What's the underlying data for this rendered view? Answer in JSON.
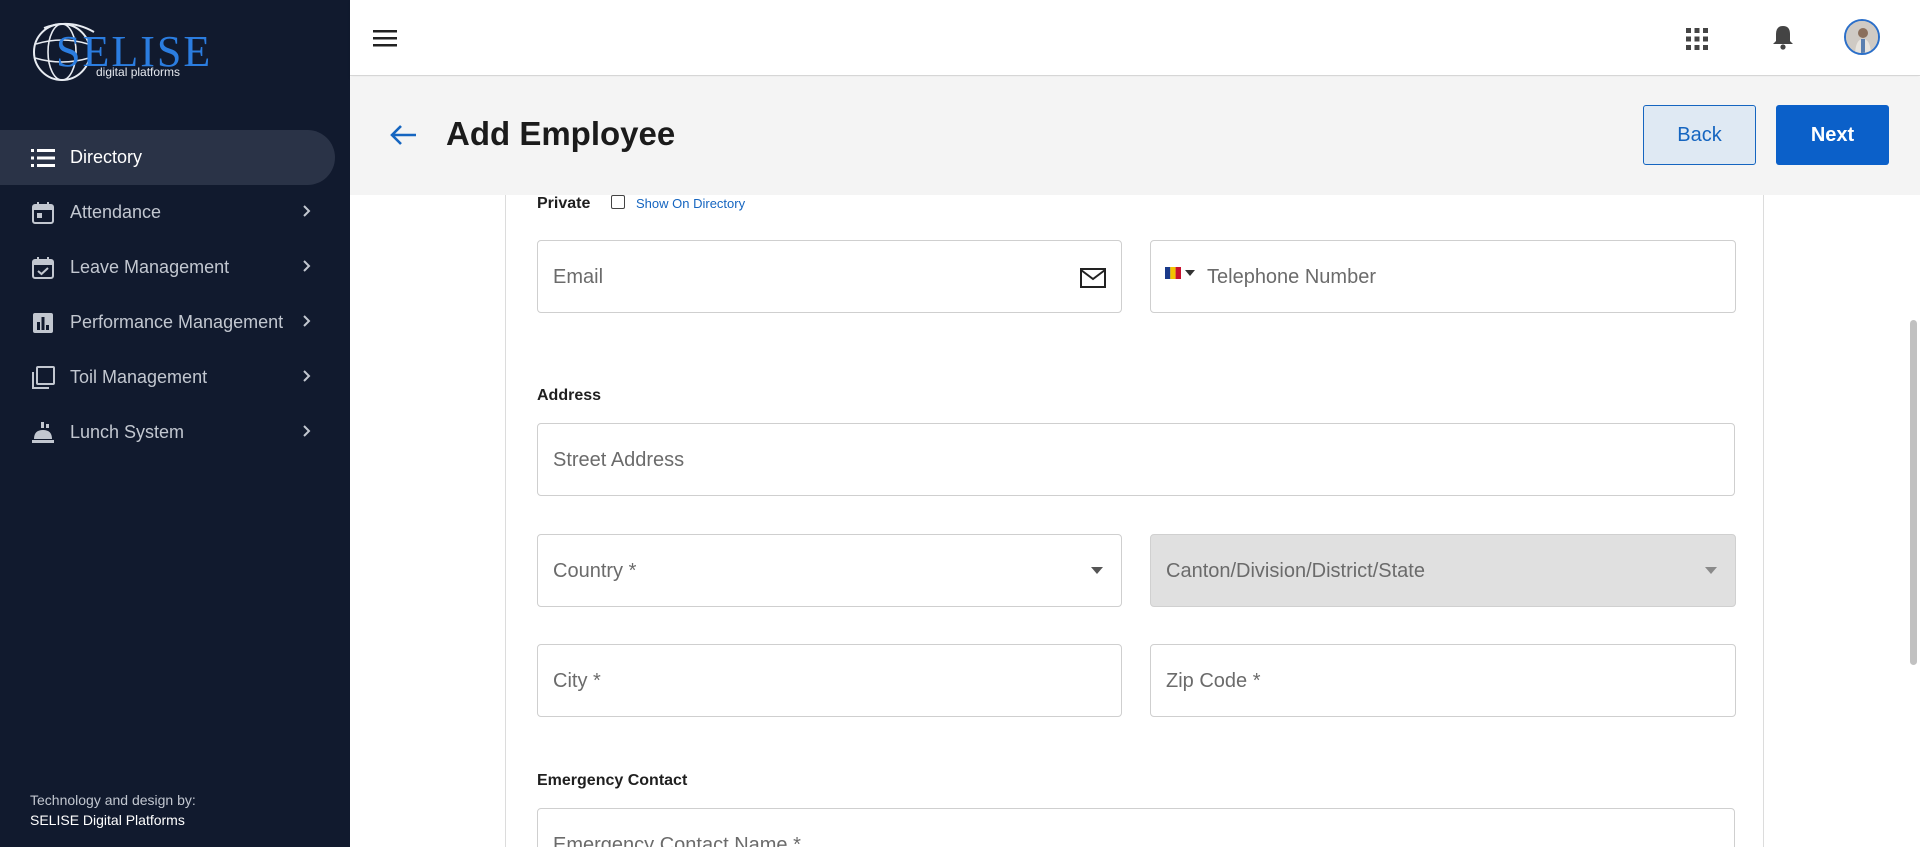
{
  "brand": {
    "logo_text": "SELISE",
    "logo_sub": "digital platforms"
  },
  "sidebar": {
    "items": [
      {
        "label": "Directory",
        "icon": "list-icon",
        "active": true
      },
      {
        "label": "Attendance",
        "icon": "calendar-icon"
      },
      {
        "label": "Leave Management",
        "icon": "calendar-check-icon"
      },
      {
        "label": "Performance Management",
        "icon": "bar-chart-icon"
      },
      {
        "label": "Toil Management",
        "icon": "copy-icon"
      },
      {
        "label": "Lunch System",
        "icon": "food-icon"
      }
    ],
    "credit_line1": "Technology and design by:",
    "credit_line2": "SELISE Digital Platforms"
  },
  "header": {
    "title": "Add Employee",
    "back_label": "Back",
    "next_label": "Next"
  },
  "form": {
    "private_label": "Private",
    "show_on_directory_label": "Show On Directory",
    "email_placeholder": "Email",
    "telephone_placeholder": "Telephone Number",
    "address_label": "Address",
    "street_placeholder": "Street Address",
    "country_placeholder": "Country *",
    "state_placeholder": "Canton/Division/District/State",
    "city_placeholder": "City *",
    "zip_placeholder": "Zip Code *",
    "emergency_label": "Emergency Contact",
    "emergency_name_placeholder": "Emergency Contact Name *"
  },
  "colors": {
    "sidebar_bg": "#111a2e",
    "accent": "#0b60c9",
    "logo_blue": "#2b7de0"
  }
}
